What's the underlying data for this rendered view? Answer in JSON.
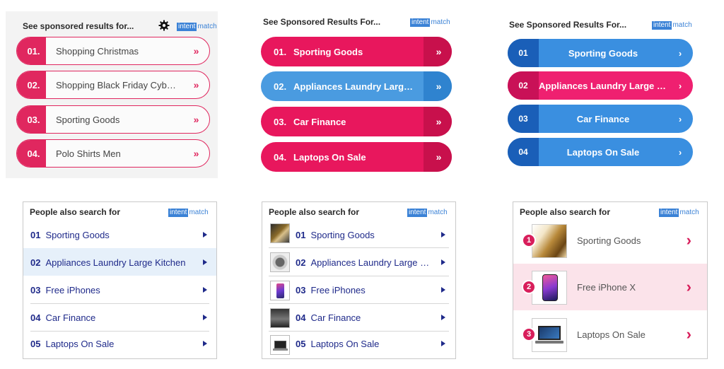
{
  "brand": {
    "logo_part1": "intent",
    "logo_part2": "match",
    "pink": "#e0275f",
    "blue": "#3a8fe0",
    "navy": "#1f2a8a"
  },
  "widget1": {
    "title": "See sponsored results for...",
    "icon": "gear-icon",
    "items": [
      {
        "num": "01.",
        "label": "Shopping Christmas",
        "arrow": "»"
      },
      {
        "num": "02.",
        "label": "Shopping Black Friday Cyber Monday",
        "arrow": "»"
      },
      {
        "num": "03.",
        "label": "Sporting Goods",
        "arrow": "»"
      },
      {
        "num": "04.",
        "label": "Polo Shirts Men",
        "arrow": "»"
      }
    ]
  },
  "widget2": {
    "title": "See Sponsored Results For...",
    "items": [
      {
        "num": "01.",
        "label": "Sporting Goods",
        "arrow": "»",
        "color": "#e8175d"
      },
      {
        "num": "02.",
        "label": "Appliances Laundry Large Kitchen",
        "arrow": "»",
        "color": "#4a9be0"
      },
      {
        "num": "03.",
        "label": "Car Finance",
        "arrow": "»",
        "color": "#e8175d"
      },
      {
        "num": "04.",
        "label": "Laptops On Sale",
        "arrow": "»",
        "color": "#e8175d"
      }
    ]
  },
  "widget3": {
    "title": "See Sponsored Results For...",
    "items": [
      {
        "num": "01",
        "label": "Sporting Goods",
        "arrow": "›"
      },
      {
        "num": "02",
        "label": "Appliances Laundry Large Kitchen",
        "arrow": "›"
      },
      {
        "num": "03",
        "label": "Car Finance",
        "arrow": "›"
      },
      {
        "num": "04",
        "label": "Laptops On Sale",
        "arrow": "›"
      }
    ]
  },
  "widget4": {
    "title": "People also search for",
    "items": [
      {
        "num": "01",
        "label": "Sporting Goods"
      },
      {
        "num": "02",
        "label": "Appliances Laundry Large Kitchen"
      },
      {
        "num": "03",
        "label": "Free iPhones"
      },
      {
        "num": "04",
        "label": "Car Finance"
      },
      {
        "num": "05",
        "label": "Laptops On Sale"
      }
    ]
  },
  "widget5": {
    "title": "People also search for",
    "items": [
      {
        "num": "01",
        "label": "Sporting Goods",
        "thumb": "sporting-goods-thumb"
      },
      {
        "num": "02",
        "label": "Appliances Laundry Large Kitchen",
        "thumb": "appliance-thumb"
      },
      {
        "num": "03",
        "label": "Free iPhones",
        "thumb": "iphone-thumb"
      },
      {
        "num": "04",
        "label": "Car Finance",
        "thumb": "car-thumb"
      },
      {
        "num": "05",
        "label": "Laptops On Sale",
        "thumb": "laptop-thumb"
      }
    ]
  },
  "widget6": {
    "title": "People also search for",
    "items": [
      {
        "num": "1",
        "label": "Sporting Goods",
        "arrow": "›"
      },
      {
        "num": "2",
        "label": "Free iPhone X",
        "arrow": "›"
      },
      {
        "num": "3",
        "label": "Laptops On Sale",
        "arrow": "›"
      }
    ]
  }
}
